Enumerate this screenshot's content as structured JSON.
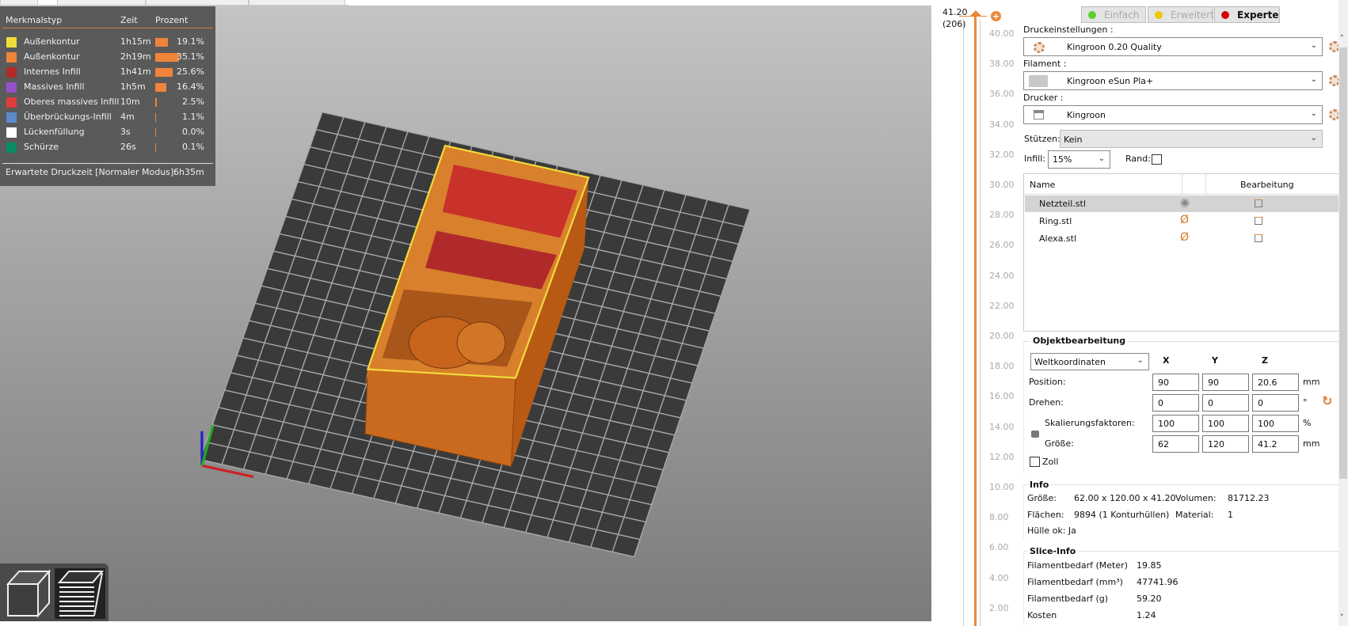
{
  "legend": {
    "headers": {
      "type": "Merkmalstyp",
      "time": "Zeit",
      "percent": "Prozent"
    },
    "rows": [
      {
        "name": "Außenkontur",
        "time": "1h15m",
        "percent": "19.1%",
        "value": 19.1,
        "color": "#f2dc3c"
      },
      {
        "name": "Außenkontur",
        "time": "2h19m",
        "percent": "35.1%",
        "value": 35.1,
        "color": "#f0843a"
      },
      {
        "name": "Internes Infill",
        "time": "1h41m",
        "percent": "25.6%",
        "value": 25.6,
        "color": "#b02a2a"
      },
      {
        "name": "Massives Infill",
        "time": "1h5m",
        "percent": "16.4%",
        "value": 16.4,
        "color": "#9650c8"
      },
      {
        "name": "Oberes massives Infill",
        "time": "10m",
        "percent": "2.5%",
        "value": 2.5,
        "color": "#e03c3c"
      },
      {
        "name": "Überbrückungs-Infill",
        "time": "4m",
        "percent": "1.1%",
        "value": 1.1,
        "color": "#5a8ccc"
      },
      {
        "name": "Lückenfüllung",
        "time": "3s",
        "percent": "0.0%",
        "value": 0.0,
        "color": "#ffffff"
      },
      {
        "name": "Schürze",
        "time": "26s",
        "percent": "0.1%",
        "value": 0.1,
        "color": "#0a8c64"
      }
    ],
    "estimate_label": "Erwartete Druckzeit [Normaler Modus]:",
    "estimate_value": "6h35m"
  },
  "slider": {
    "top_value": "41.20",
    "top_layer": "(206)",
    "ticks": [
      "40.00",
      "38.00",
      "36.00",
      "34.00",
      "32.00",
      "30.00",
      "28.00",
      "26.00",
      "24.00",
      "22.00",
      "20.00",
      "18.00",
      "16.00",
      "14.00",
      "12.00",
      "10.00",
      "8.00",
      "6.00",
      "4.00",
      "2.00"
    ]
  },
  "modes": [
    {
      "label": "Einfach",
      "color": "#5ad232",
      "active": false
    },
    {
      "label": "Erweitert",
      "color": "#f0c800",
      "active": false
    },
    {
      "label": "Experte",
      "color": "#d20000",
      "active": true
    }
  ],
  "settings": {
    "print_label": "Druckeinstellungen :",
    "print_value": "Kingroon 0.20 Quality",
    "filament_label": "Filament :",
    "filament_value": "Kingroon eSun Pla+",
    "printer_label": "Drucker :",
    "printer_value": "Kingroon",
    "supports_label": "Stützen:",
    "supports_value": "Kein",
    "infill_label": "Infill:",
    "infill_value": "15%",
    "brim_label": "Rand:"
  },
  "objects": {
    "col_name": "Name",
    "col_edit": "Bearbeitung",
    "rows": [
      {
        "name": "Netzteil.stl",
        "visible": true
      },
      {
        "name": "Ring.stl",
        "visible": false
      },
      {
        "name": "Alexa.stl",
        "visible": false
      }
    ]
  },
  "manipulation": {
    "title": "Objektbearbeitung",
    "coord_system": "Weltkoordinaten",
    "axes": [
      "X",
      "Y",
      "Z"
    ],
    "rows": [
      {
        "label": "Position:",
        "values": [
          "90",
          "90",
          "20.6"
        ],
        "unit": "mm"
      },
      {
        "label": "Drehen:",
        "values": [
          "0",
          "0",
          "0"
        ],
        "unit": "°"
      },
      {
        "label": "Skalierungsfaktoren:",
        "values": [
          "100",
          "100",
          "100"
        ],
        "unit": "%"
      },
      {
        "label": "Größe:",
        "values": [
          "62",
          "120",
          "41.2"
        ],
        "unit": "mm"
      }
    ],
    "inches_label": "Zoll"
  },
  "info": {
    "title": "Info",
    "size_label": "Größe:",
    "size_value": "62.00 x 120.00 x 41.20",
    "volume_label": "Volumen:",
    "volume_value": "81712.23",
    "facets_label": "Flächen:",
    "facets_value": "9894 (1 Konturhüllen)",
    "material_label": "Material:",
    "material_value": "1",
    "manifold": "Hülle ok: Ja"
  },
  "slice_info": {
    "title": "Slice-Info",
    "rows": [
      {
        "label": "Filamentbedarf (Meter)",
        "value": "19.85"
      },
      {
        "label": "Filamentbedarf (mm³)",
        "value": "47741.96"
      },
      {
        "label": "Filamentbedarf (g)",
        "value": "59.20"
      },
      {
        "label": "Kosten",
        "value": "1.24"
      }
    ]
  }
}
